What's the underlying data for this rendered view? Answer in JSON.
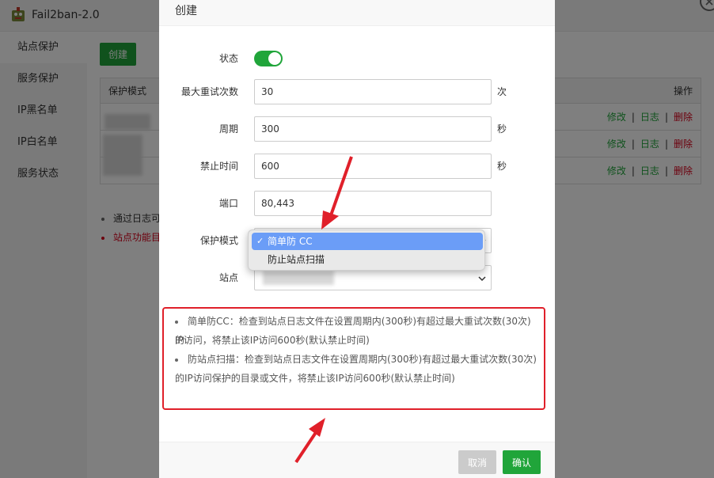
{
  "app": {
    "title": "Fail2ban-2.0"
  },
  "sidebar": {
    "items": [
      {
        "label": "站点保护"
      },
      {
        "label": "服务保护"
      },
      {
        "label": "IP黑名单"
      },
      {
        "label": "IP白名单"
      },
      {
        "label": "服务状态"
      }
    ]
  },
  "main": {
    "create_label": "创建",
    "table": {
      "col_mode": "保护模式",
      "col_ops": "操作",
      "rows": [
        {
          "edit": "修改",
          "log": "日志",
          "del": "删除"
        },
        {
          "edit": "修改",
          "log": "日志",
          "del": "删除"
        },
        {
          "edit": "修改",
          "log": "日志",
          "del": "删除"
        }
      ],
      "sep": "|"
    },
    "tips": [
      {
        "text": "通过日志可"
      },
      {
        "text": "站点功能目"
      }
    ]
  },
  "modal": {
    "title": "创建",
    "fields": {
      "status_label": "状态",
      "retry_label": "最大重试次数",
      "retry_value": "30",
      "retry_unit": "次",
      "period_label": "周期",
      "period_value": "300",
      "period_unit": "秒",
      "ban_label": "禁止时间",
      "ban_value": "600",
      "ban_unit": "秒",
      "port_label": "端口",
      "port_value": "80,443",
      "mode_label": "保护模式",
      "site_label": "站点"
    },
    "dropdown": {
      "options": [
        {
          "label": "简单防 CC",
          "selected": true
        },
        {
          "label": "防止站点扫描",
          "selected": false
        }
      ]
    },
    "descriptions": [
      "简单防CC：检查到站点日志文件在设置周期内(300秒)有超过最大重试次数(30次)的",
      "IP访问，将禁止该IP访问600秒(默认禁止时间)",
      "防站点扫描：检查到站点日志文件在设置周期内(300秒)有超过最大重试次数(30次)",
      "的IP访问保护的目录或文件，将禁止该IP访问600秒(默认禁止时间)"
    ],
    "footer": {
      "cancel_label": "取消",
      "ok_label": "确认"
    }
  },
  "colors": {
    "accent": "#20a53a",
    "danger": "#d9001b",
    "annotation": "#e0202a",
    "dropdown_highlight": "#6b9df7"
  }
}
